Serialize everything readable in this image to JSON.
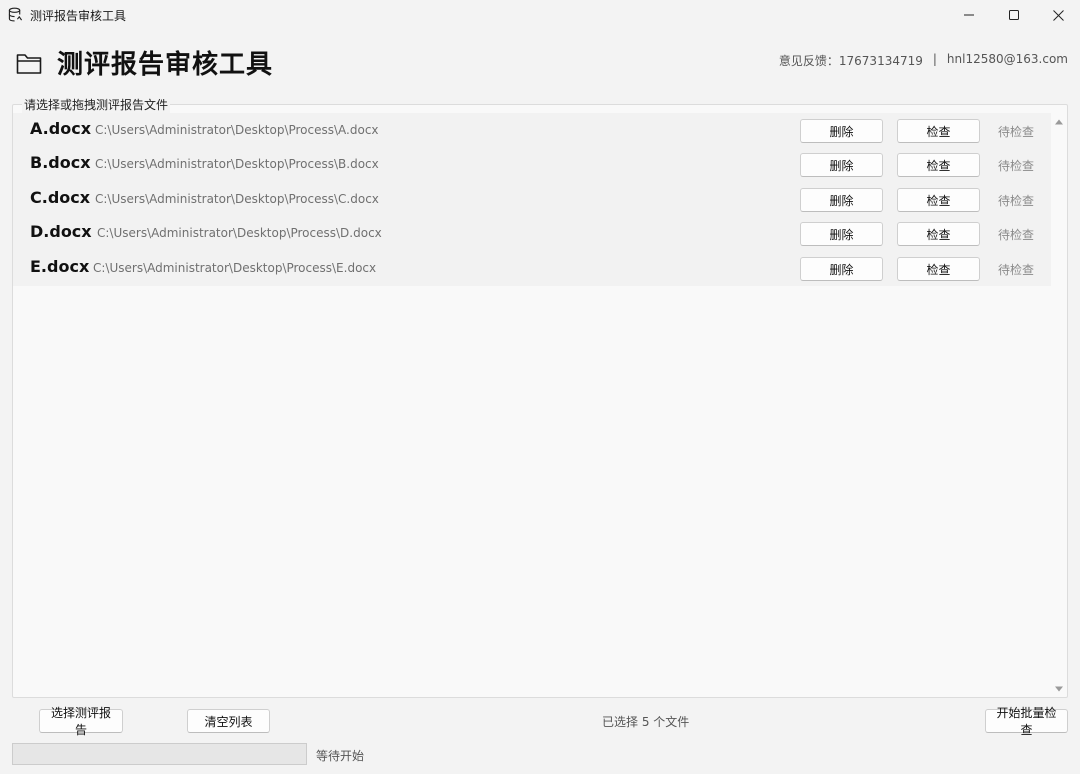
{
  "window": {
    "title": "测评报告审核工具",
    "controls": [
      "minimize-icon",
      "maximize-icon",
      "close-icon"
    ]
  },
  "header": {
    "title": "测评报告审核工具",
    "icon": "folder-icon",
    "feedback_label": "意见反馈：17673134719",
    "separator": "|",
    "email": "hnl12580@163.com"
  },
  "group": {
    "legend": "请选择或拖拽测评报告文件"
  },
  "files": [
    {
      "name": "A.docx",
      "path": "C:\\Users\\Administrator\\Desktop\\Process\\A.docx",
      "delete_label": "删除",
      "check_label": "检查",
      "status": "待检查"
    },
    {
      "name": "B.docx",
      "path": "C:\\Users\\Administrator\\Desktop\\Process\\B.docx",
      "delete_label": "删除",
      "check_label": "检查",
      "status": "待检查"
    },
    {
      "name": "C.docx",
      "path": "C:\\Users\\Administrator\\Desktop\\Process\\C.docx",
      "delete_label": "删除",
      "check_label": "检查",
      "status": "待检查"
    },
    {
      "name": "D.docx",
      "path": "C:\\Users\\Administrator\\Desktop\\Process\\D.docx",
      "delete_label": "删除",
      "check_label": "检查",
      "status": "待检查"
    },
    {
      "name": "E.docx",
      "path": "C:\\Users\\Administrator\\Desktop\\Process\\E.docx",
      "delete_label": "删除",
      "check_label": "检查",
      "status": "待检查"
    }
  ],
  "footer": {
    "select_button": "选择测评报告",
    "clear_button": "清空列表",
    "selected_count": "已选择 5 个文件",
    "start_button": "开始批量检查",
    "progress_fraction": 0,
    "status": "等待开始"
  },
  "colors": {
    "window_bg": "#f3f3f3",
    "list_bg": "#f2f2f2",
    "muted_text": "#8a8a8a",
    "progress_fill": "#3c8dde"
  }
}
